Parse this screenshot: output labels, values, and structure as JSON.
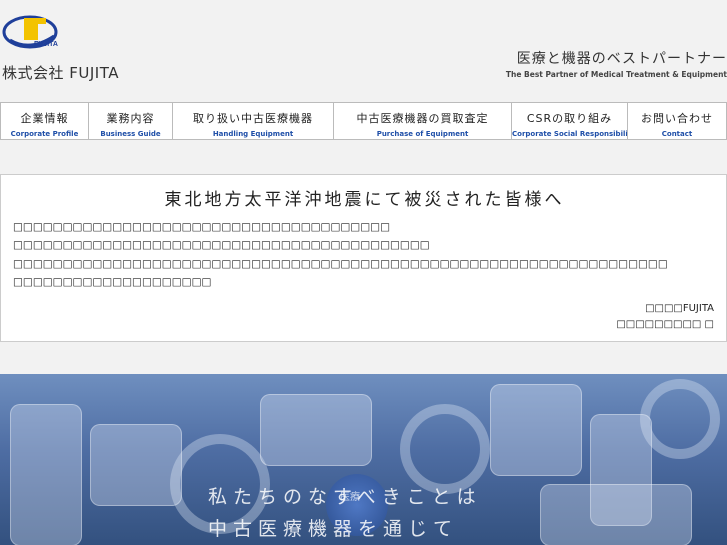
{
  "header": {
    "logo_text": "FUJITA",
    "company_name": "株式会社 FUJITA",
    "tagline_jp": "医療と機器のベストパートナー",
    "tagline_en": "The Best Partner of Medical Treatment & Equipment"
  },
  "nav": [
    {
      "jp": "企業情報",
      "en": "Corporate Profile"
    },
    {
      "jp": "業務内容",
      "en": "Business Guide"
    },
    {
      "jp": "取り扱い中古医療機器",
      "en": "Handling Equipment"
    },
    {
      "jp": "中古医療機器の買取査定",
      "en": "Purchase of  Equipment"
    },
    {
      "jp": "CSRの取り組み",
      "en": "Corporate Social Responsibility"
    },
    {
      "jp": "お問い合わせ",
      "en": "Contact"
    }
  ],
  "notice": {
    "title": "東北地方太平洋沖地震にて被災された皆様へ",
    "lines": [
      "□□□□□□□□□□□□□□□□□□□□□□□□□□□□□□□□□□□□□□",
      "□□□□□□□□□□□□□□□□□□□□□□□□□□□□□□□□□□□□□□□□□□",
      "□□□□□□□□□□□□□□□□□□□□□□□□□□□□□□□□□□□□□□□□□□□□□□□□□□□□□□□□□□□□□□□□□□",
      "□□□□□□□□□□□□□□□□□□□□"
    ],
    "sign_company": "□□□□FUJITA",
    "sign_name": "□□□□□□□□□ □"
  },
  "hero": {
    "line1": "私たちのなすべきことは",
    "line2": "中古医療機器を通じて",
    "badge": "医療"
  }
}
